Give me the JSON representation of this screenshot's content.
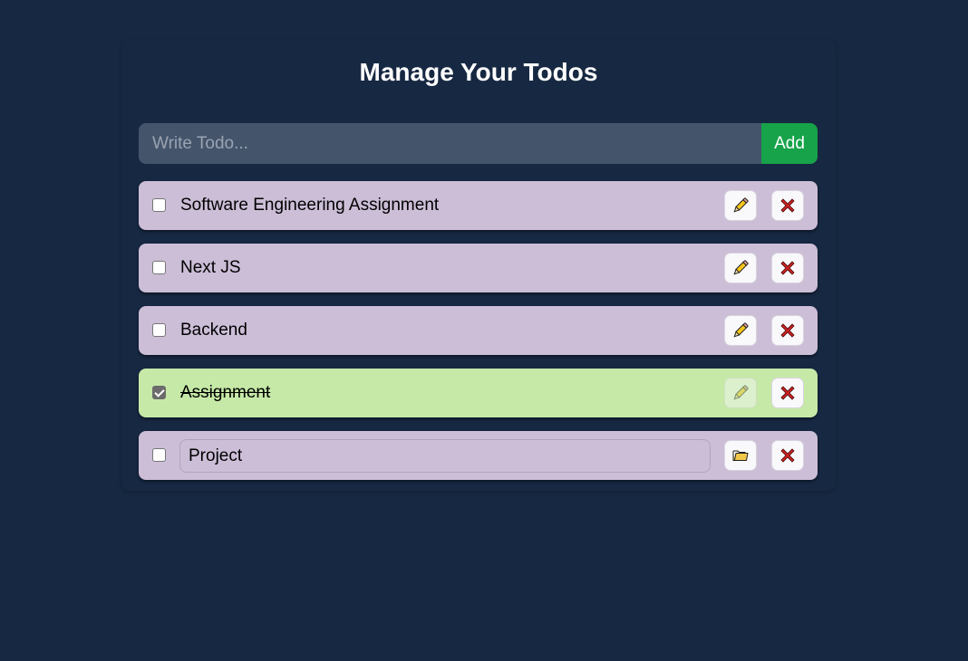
{
  "header": {
    "title": "Manage Your Todos"
  },
  "form": {
    "placeholder": "Write Todo...",
    "value": "",
    "add_label": "Add"
  },
  "todos": [
    {
      "text": "Software Engineering Assignment",
      "completed": false,
      "editing": false
    },
    {
      "text": "Next JS",
      "completed": false,
      "editing": false
    },
    {
      "text": "Backend",
      "completed": false,
      "editing": false
    },
    {
      "text": "Assignment",
      "completed": true,
      "editing": false
    },
    {
      "text": "Project",
      "completed": false,
      "editing": true
    }
  ],
  "icons": {
    "edit": "pencil-icon",
    "save": "folder-icon",
    "delete": "close-icon"
  },
  "colors": {
    "background": "#172842",
    "input_bg": "#44546b",
    "add_button": "#17a34a",
    "todo_pending": "#ccbed7",
    "todo_done": "#c6e9a7",
    "delete_icon": "#cc2222"
  }
}
